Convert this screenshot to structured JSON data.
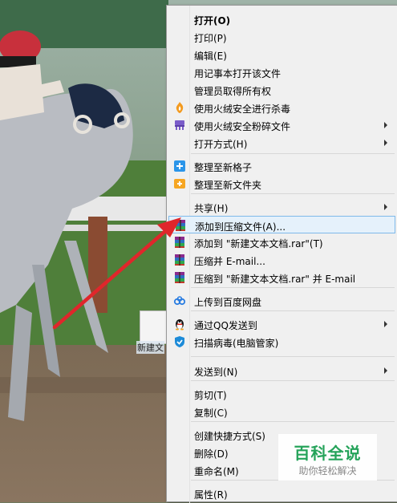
{
  "desktop": {
    "file_label": "新建文"
  },
  "context_menu": {
    "items": [
      {
        "label": "打开(O)",
        "bold": true,
        "icon": "",
        "submenu": false
      },
      {
        "label": "打印(P)",
        "icon": "",
        "submenu": false
      },
      {
        "label": "编辑(E)",
        "icon": "",
        "submenu": false
      },
      {
        "label": "用记事本打开该文件",
        "icon": "",
        "submenu": false
      },
      {
        "label": "管理员取得所有权",
        "icon": "",
        "submenu": false
      },
      {
        "label": "使用火绒安全进行杀毒",
        "icon": "huorong-shield-icon",
        "submenu": false
      },
      {
        "label": "使用火绒安全粉碎文件",
        "icon": "shredder-icon",
        "submenu": true
      },
      {
        "label": "打开方式(H)",
        "icon": "",
        "submenu": true
      },
      {
        "label": "整理至新格子",
        "icon": "blue-plus-icon",
        "submenu": false
      },
      {
        "label": "整理至新文件夹",
        "icon": "orange-plus-icon",
        "submenu": false
      },
      {
        "label": "共享(H)",
        "icon": "",
        "submenu": true
      },
      {
        "label": "添加到压缩文件(A)...",
        "icon": "winrar-icon",
        "submenu": false,
        "highlighted": true
      },
      {
        "label": "添加到 \"新建文本文档.rar\"(T)",
        "icon": "winrar-icon",
        "submenu": false
      },
      {
        "label": "压缩并 E-mail...",
        "icon": "winrar-icon",
        "submenu": false
      },
      {
        "label": "压缩到 \"新建文本文档.rar\" 并 E-mail",
        "icon": "winrar-icon",
        "submenu": false
      },
      {
        "label": "上传到百度网盘",
        "icon": "baidu-cloud-icon",
        "submenu": false
      },
      {
        "label": "通过QQ发送到",
        "icon": "qq-penguin-icon",
        "submenu": true
      },
      {
        "label": "扫描病毒(电脑管家)",
        "icon": "tencent-shield-icon",
        "submenu": false
      },
      {
        "label": "发送到(N)",
        "icon": "",
        "submenu": true
      },
      {
        "label": "剪切(T)",
        "icon": "",
        "submenu": false
      },
      {
        "label": "复制(C)",
        "icon": "",
        "submenu": false
      },
      {
        "label": "创建快捷方式(S)",
        "icon": "",
        "submenu": false
      },
      {
        "label": "删除(D)",
        "icon": "",
        "submenu": false
      },
      {
        "label": "重命名(M)",
        "icon": "",
        "submenu": false
      },
      {
        "label": "属性(R)",
        "icon": "",
        "submenu": false
      }
    ]
  },
  "watermark": {
    "title": "百科全说",
    "subtitle": "助你轻松解决"
  },
  "colors": {
    "highlight_bg": "#e5f1fb",
    "highlight_border": "#7fb9ea",
    "arrow": "#e0262b",
    "watermark_green": "#25a35a"
  }
}
